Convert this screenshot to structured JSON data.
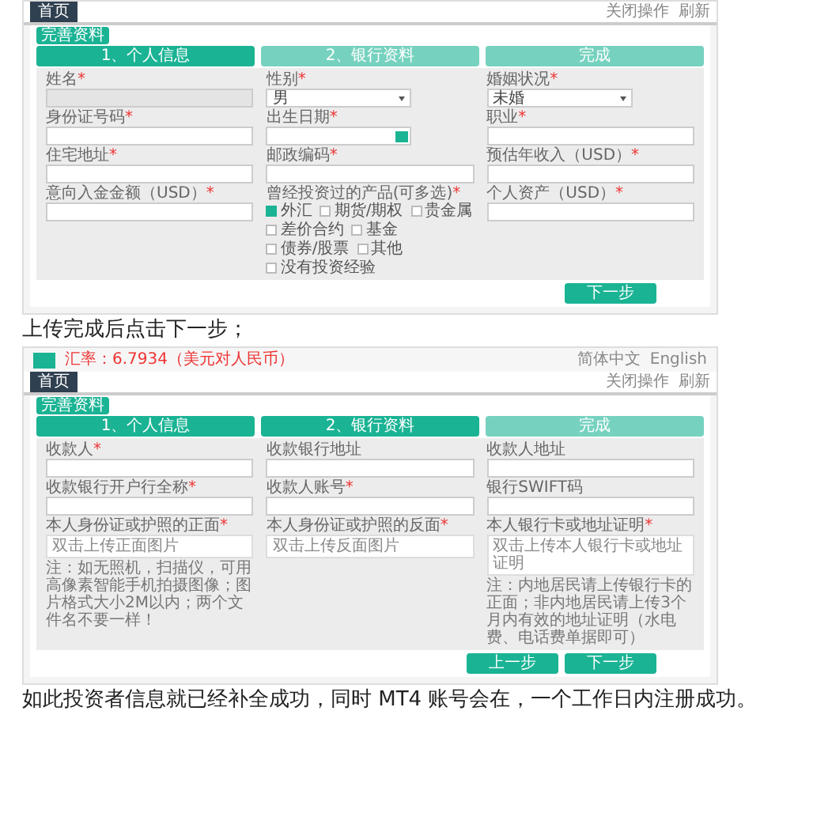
{
  "blocks": [
    {
      "kind": "frame",
      "nav": {
        "tab": "首页",
        "links": [
          "关闭操作",
          "刷新"
        ]
      },
      "badge": "完善资料",
      "steps": [
        {
          "label": "1、个人信息",
          "done": true
        },
        {
          "label": "2、银行资料",
          "done": false
        },
        {
          "label": "完成",
          "done": false
        }
      ],
      "fields": [
        {
          "kind": "disabled",
          "label": "姓名",
          "required": "*"
        },
        {
          "kind": "select",
          "label": "性别",
          "required": "*",
          "value": "男"
        },
        {
          "kind": "select",
          "label": "婚姻状况",
          "required": "*",
          "value": "未婚"
        },
        {
          "kind": "input",
          "label": "身份证号码",
          "required": "*"
        },
        {
          "kind": "date",
          "label": "出生日期",
          "required": "*"
        },
        {
          "kind": "input",
          "label": "职业",
          "required": "*"
        },
        {
          "kind": "input",
          "label": "住宅地址",
          "required": "*"
        },
        {
          "kind": "input",
          "label": "邮政编码",
          "required": "*"
        },
        {
          "kind": "input",
          "label": "预估年收入（USD）",
          "required": "*"
        },
        {
          "kind": "input",
          "label": "意向入金金额（USD）",
          "required": "*"
        },
        {
          "kind": "checkboxes",
          "label": "曾经投资过的产品(可多选)",
          "required": "*",
          "options": [
            {
              "label": "外汇",
              "checked": true
            },
            {
              "label": "期货/期权",
              "checked": false
            },
            {
              "label": "贵金属",
              "checked": false
            },
            {
              "label": "差价合约",
              "checked": false
            },
            {
              "label": "基金",
              "checked": false
            },
            {
              "label": "债券/股票",
              "checked": false
            },
            {
              "label": "其他",
              "checked": false
            },
            {
              "label": "没有投资经验",
              "checked": false
            }
          ]
        },
        {
          "kind": "input",
          "label": "个人资产（USD）",
          "required": "*"
        }
      ],
      "buttons": [
        "下一步"
      ]
    },
    {
      "kind": "caption",
      "text": "上传完成后点击下一步；"
    },
    {
      "kind": "frame",
      "header": {
        "rate": "汇率：6.7934（美元对人民币）",
        "langs": [
          "简体中文",
          "English"
        ]
      },
      "nav": {
        "tab": "首页",
        "links": [
          "关闭操作",
          "刷新"
        ]
      },
      "badge": "完善资料",
      "steps": [
        {
          "label": "1、个人信息",
          "done": true
        },
        {
          "label": "2、银行资料",
          "done": true
        },
        {
          "label": "完成",
          "done": false
        }
      ],
      "fields": [
        {
          "kind": "input",
          "label": "收款人",
          "required": "*"
        },
        {
          "kind": "input",
          "label": "收款银行地址"
        },
        {
          "kind": "input",
          "label": "收款人地址"
        },
        {
          "kind": "input",
          "label": "收款银行开户行全称",
          "required": "*"
        },
        {
          "kind": "input",
          "label": "收款人账号",
          "required": "*"
        },
        {
          "kind": "input",
          "label": "银行SWIFT码"
        },
        {
          "kind": "upload",
          "label": "本人身份证或护照的正面",
          "required": "*",
          "placeholder": "双击上传正面图片",
          "note": "注：如无照机，扫描仪，可用高像素智能手机拍摄图像；图片格式大小2M以内；两个文件名不要一样！"
        },
        {
          "kind": "upload",
          "label": "本人身份证或护照的反面",
          "required": "*",
          "placeholder": "双击上传反面图片"
        },
        {
          "kind": "upload",
          "label": "本人银行卡或地址证明",
          "required": "*",
          "placeholder": "双击上传本人银行卡或地址证明",
          "note": "注：内地居民请上传银行卡的正面；非内地居民请上传3个月内有效的地址证明（水电费、电话费单据即可）"
        }
      ],
      "buttons": [
        "上一步",
        "下一步"
      ]
    },
    {
      "kind": "caption",
      "text": "如此投资者信息就已经补全成功，同时 MT4 账号会在，一个工作日内注册成功。"
    }
  ]
}
